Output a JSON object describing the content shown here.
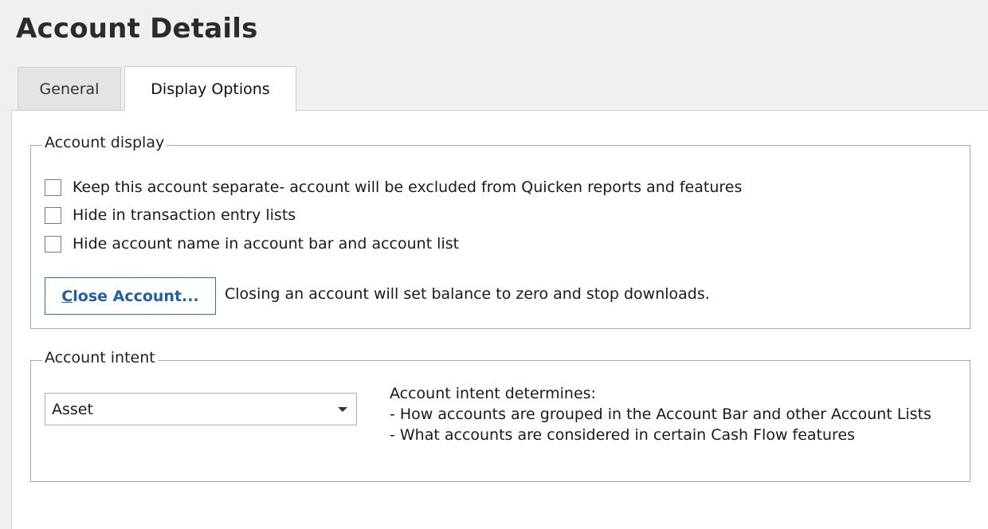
{
  "window": {
    "title": "Account Details"
  },
  "tabs": [
    {
      "label": "General",
      "active": false
    },
    {
      "label": "Display Options",
      "active": true
    }
  ],
  "account_display": {
    "legend": "Account display",
    "checkboxes": [
      {
        "label": "Keep this account separate- account will be excluded from Quicken reports and features",
        "checked": false
      },
      {
        "label": "Hide in transaction entry lists",
        "checked": false
      },
      {
        "label": "Hide account name in account bar and account list",
        "checked": false
      }
    ],
    "close_button": {
      "accelerator": "C",
      "label_rest": "lose Account..."
    },
    "close_note": "Closing an account will set balance to zero and stop downloads."
  },
  "account_intent": {
    "legend": "Account intent",
    "select": {
      "value": "Asset",
      "arrow_icon": "chevron-down-icon"
    },
    "info": {
      "heading": "Account intent determines:",
      "lines": [
        "- How accounts are grouped in the Account Bar and other Account Lists",
        "- What accounts are considered in certain Cash Flow features"
      ]
    }
  },
  "colors": {
    "accent_blue": "#2d72b8",
    "background": "#f0f0f0",
    "panel": "#ffffff"
  }
}
